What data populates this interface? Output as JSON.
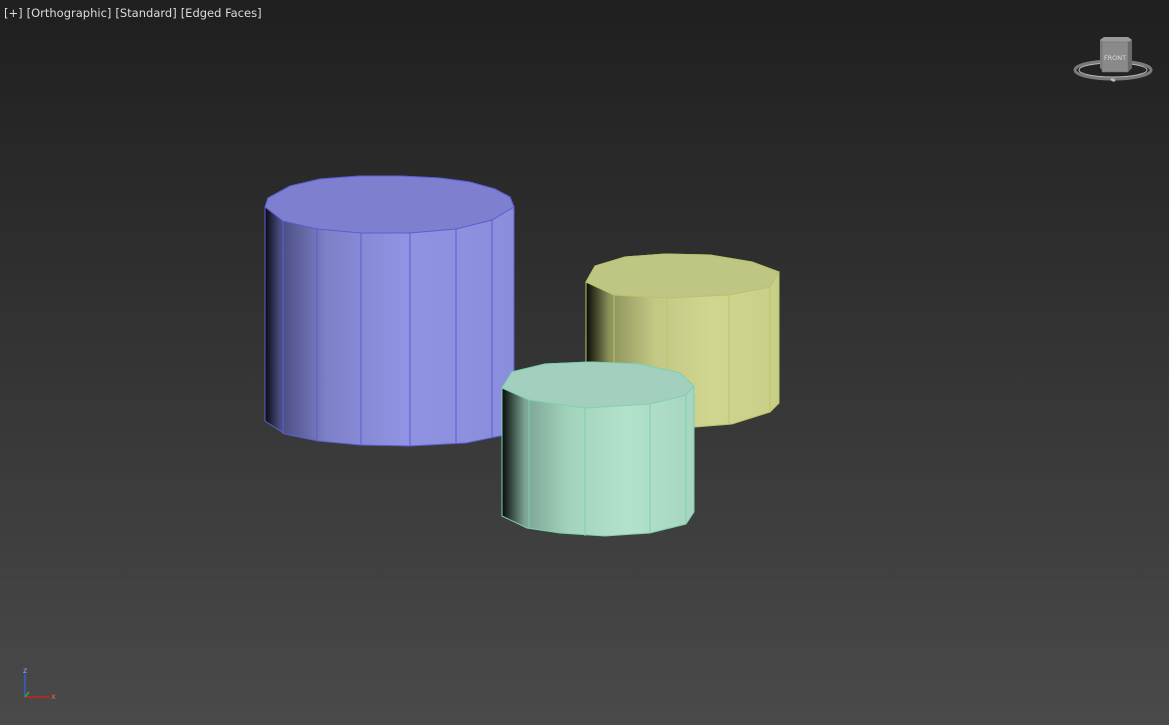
{
  "viewport": {
    "labels": [
      {
        "text": "[+]"
      },
      {
        "text": "[Orthographic]"
      },
      {
        "text": "[Standard]"
      },
      {
        "text": "[Edged Faces]"
      }
    ],
    "viewcube": {
      "face_label": "FRONT"
    },
    "axis": {
      "x": "x",
      "z": "z"
    },
    "colors": {
      "cylinder_large": "#8c8fe0",
      "cylinder_yellow": "#cdd48a",
      "cylinder_mint": "#aee0c8"
    }
  }
}
